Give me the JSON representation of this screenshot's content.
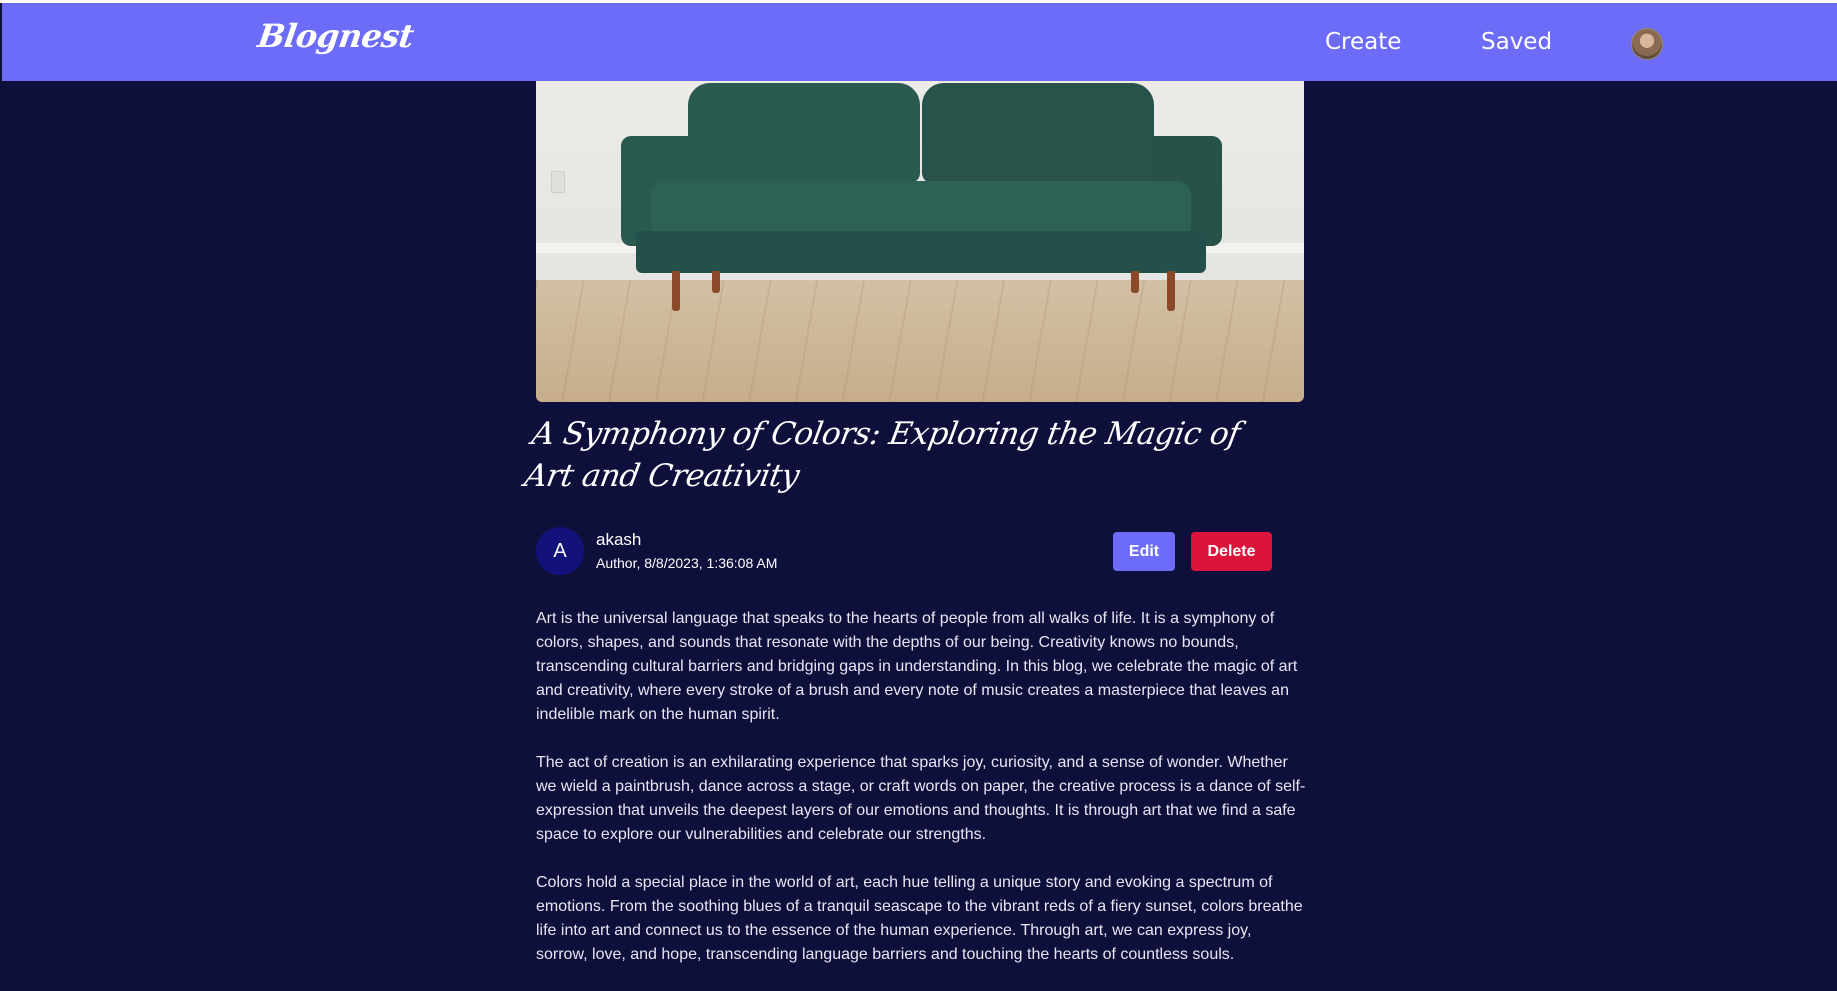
{
  "nav": {
    "logo": "Blognest",
    "create_label": "Create",
    "saved_label": "Saved"
  },
  "post": {
    "title": "A Symphony of Colors: Exploring the Magic of Art and Creativity",
    "author_initial": "A",
    "author_name": "akash",
    "author_meta": "Author, 8/8/2023, 1:36:08 AM",
    "edit_label": "Edit",
    "delete_label": "Delete",
    "paragraphs": [
      "Art is the universal language that speaks to the hearts of people from all walks of life. It is a symphony of colors, shapes, and sounds that resonate with the depths of our being. Creativity knows no bounds, transcending cultural barriers and bridging gaps in understanding. In this blog, we celebrate the magic of art and creativity, where every stroke of a brush and every note of music creates a masterpiece that leaves an indelible mark on the human spirit.",
      "The act of creation is an exhilarating experience that sparks joy, curiosity, and a sense of wonder. Whether we wield a paintbrush, dance across a stage, or craft words on paper, the creative process is a dance of self-expression that unveils the deepest layers of our emotions and thoughts. It is through art that we find a safe space to explore our vulnerabilities and celebrate our strengths.",
      "Colors hold a special place in the world of art, each hue telling a unique story and evoking a spectrum of emotions. From the soothing blues of a tranquil seascape to the vibrant reds of a fiery sunset, colors breathe life into art and connect us to the essence of the human experience. Through art, we can express joy, sorrow, love, and hope, transcending language barriers and touching the hearts of countless souls."
    ]
  },
  "colors": {
    "navbar": "#6c6cf8",
    "background": "#0f0f3c",
    "edit_button": "#6c6cf8",
    "delete_button": "#dc143c",
    "author_avatar": "#12127a"
  }
}
